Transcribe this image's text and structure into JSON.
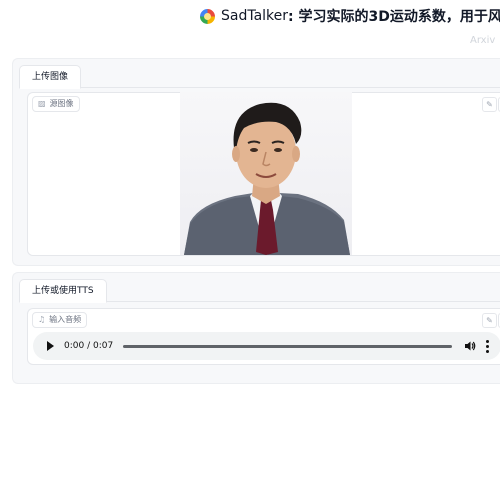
{
  "header": {
    "app_name": "SadTalker",
    "title_rest": ": 学习实际的3D运动系数，用于风",
    "links_text": "Arxiv"
  },
  "image_section": {
    "tab_label": "上传图像",
    "block_label": "源图像",
    "edit_icon": "pencil-icon",
    "clear_icon": "close-icon"
  },
  "audio_section": {
    "tab_label": "上传或使用TTS",
    "block_label": "输入音频",
    "edit_icon": "pencil-icon",
    "clear_icon": "close-icon",
    "player": {
      "time": "0:00 / 0:07",
      "progress": 0.0
    }
  }
}
